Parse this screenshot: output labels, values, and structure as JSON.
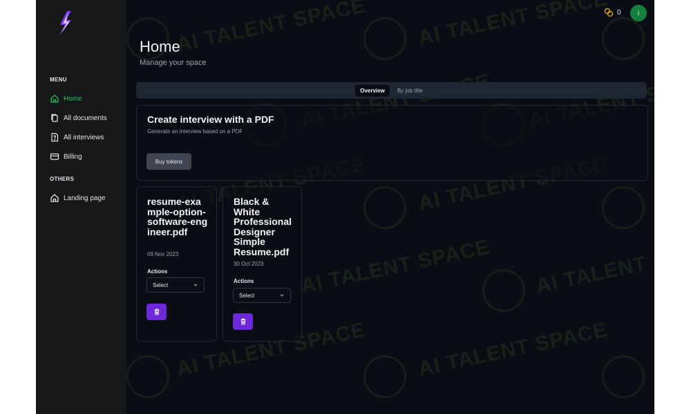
{
  "sidebar": {
    "menu_label": "MENU",
    "items": [
      {
        "label": "Home",
        "icon": "home-icon",
        "active": true
      },
      {
        "label": "All documents",
        "icon": "documents-icon"
      },
      {
        "label": "All interviews",
        "icon": "interview-file-icon"
      },
      {
        "label": "Billing",
        "icon": "credit-card-icon"
      }
    ],
    "others_label": "OTHERS",
    "others": [
      {
        "label": "Landing page",
        "icon": "home-icon"
      }
    ]
  },
  "header": {
    "token_count": "0",
    "avatar_initial": "i"
  },
  "page": {
    "title": "Home",
    "subtitle": "Manage your space"
  },
  "tabs": [
    {
      "label": "Overview",
      "active": true
    },
    {
      "label": "By job title"
    }
  ],
  "create_card": {
    "title": "Create interview with a PDF",
    "subtitle": "Generate an interview based on a PDF",
    "button_label": "Buy tokens"
  },
  "documents": [
    {
      "name": "resume-example-option-software-engineer.pdf",
      "date": "09 Nov 2023",
      "actions_label": "Actions",
      "select_value": "Select"
    },
    {
      "name": "Black & White Professional Designer Simple Resume.pdf",
      "date": "30 Oct 2023",
      "actions_label": "Actions",
      "select_value": "Select"
    }
  ],
  "watermark_text": "AI TALENT SPACE",
  "colors": {
    "background": "#0a0d14",
    "sidebar": "#161718",
    "active_nav": "#22c55e",
    "delete_button": "#6d28d9",
    "avatar": "#15803d",
    "token_icon": "#d4a017"
  }
}
